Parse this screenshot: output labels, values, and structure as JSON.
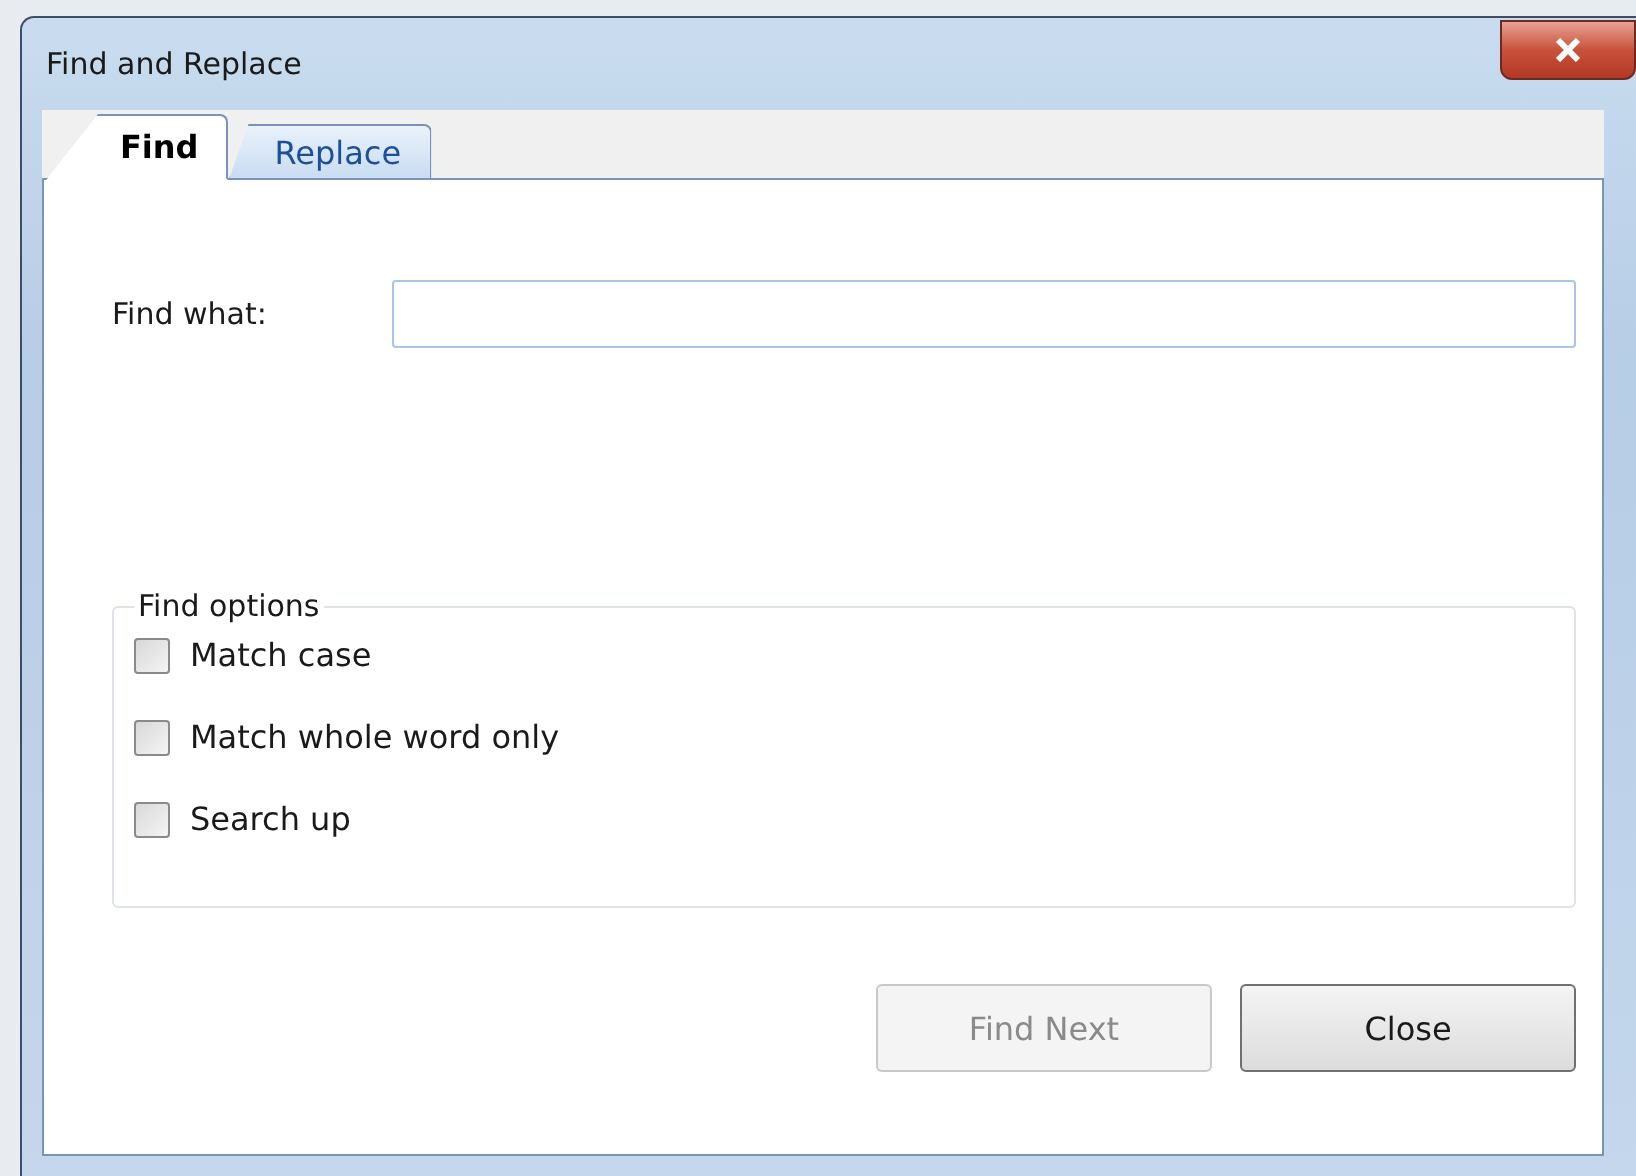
{
  "window": {
    "title": "Find and Replace"
  },
  "tabs": [
    {
      "label": "Find",
      "selected": true
    },
    {
      "label": "Replace",
      "selected": false
    }
  ],
  "find_what": {
    "label": "Find what:"
  },
  "find_options": {
    "title": "Find options",
    "options": [
      {
        "label": "Match case",
        "checked": false
      },
      {
        "label": "Match whole word only",
        "checked": false
      },
      {
        "label": "Search up",
        "checked": false
      }
    ]
  },
  "buttons": [
    {
      "label": "Find Next",
      "disabled": true
    },
    {
      "label": "Close",
      "disabled": false
    }
  ]
}
